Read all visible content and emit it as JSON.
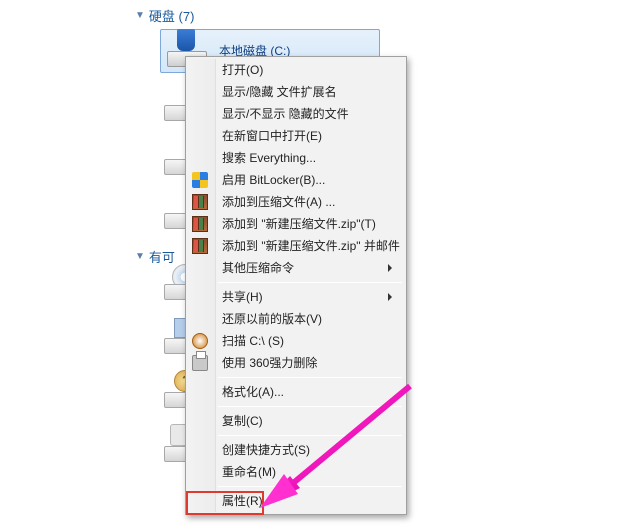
{
  "sections": {
    "drives": {
      "label": "硬盘 (7)"
    },
    "removable": {
      "label": "有可"
    }
  },
  "selected_drive": {
    "label": "本地磁盘 (C:)"
  },
  "context_menu": {
    "open": "打开(O)",
    "show_hide_ext": "显示/隐藏 文件扩展名",
    "show_hide_hidden": "显示/不显示 隐藏的文件",
    "open_new_window": "在新窗口中打开(E)",
    "search_everything": "搜索 Everything...",
    "bitlocker": "启用 BitLocker(B)...",
    "add_to_archive": "添加到压缩文件(A) ...",
    "add_to_zip": "添加到 \"新建压缩文件.zip\"(T)",
    "add_to_zip_mail": "添加到 \"新建压缩文件.zip\" 并邮件",
    "other_compress": "其他压缩命令",
    "share": "共享(H)",
    "restore_versions": "还原以前的版本(V)",
    "scan_c": "扫描 C:\\ (S)",
    "force_delete": "使用 360强力删除",
    "format": "格式化(A)...",
    "copy": "复制(C)",
    "create_shortcut": "创建快捷方式(S)",
    "rename": "重命名(M)",
    "properties": "属性(R)"
  }
}
